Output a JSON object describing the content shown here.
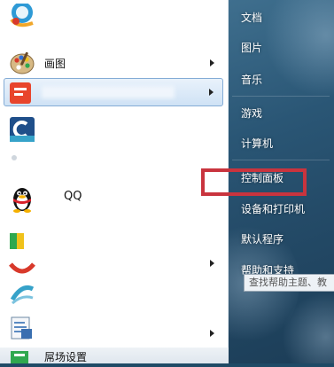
{
  "left_menu": {
    "items": [
      {
        "id": "top-app",
        "label": "",
        "icon": "browser-icon",
        "has_arrow": false
      },
      {
        "id": "paint",
        "label": "画图",
        "icon": "paint-palette-icon",
        "has_arrow": true
      },
      {
        "id": "pinned-app",
        "label": "",
        "icon": "app-icon",
        "has_arrow": true
      },
      {
        "id": "app-c",
        "label": "",
        "icon": "c-app-icon",
        "has_arrow": false
      },
      {
        "id": "qq",
        "label": "QQ",
        "icon": "qq-penguin-icon",
        "has_arrow": false
      },
      {
        "id": "green-app",
        "label": "",
        "icon": "green-app-icon",
        "has_arrow": false
      },
      {
        "id": "red-app",
        "label": "",
        "icon": "red-app-icon",
        "has_arrow": true
      },
      {
        "id": "teal-app",
        "label": "",
        "icon": "teal-app-icon",
        "has_arrow": false
      },
      {
        "id": "doc-app",
        "label": "",
        "icon": "document-app-icon",
        "has_arrow": true
      },
      {
        "id": "settings-partial",
        "label": "屌场设置",
        "icon": "settings-app-icon",
        "has_arrow": false
      }
    ]
  },
  "right_menu": {
    "items": [
      {
        "id": "documents",
        "label": "文档"
      },
      {
        "id": "pictures",
        "label": "图片"
      },
      {
        "id": "music",
        "label": "音乐"
      },
      {
        "id": "games",
        "label": "游戏"
      },
      {
        "id": "computer",
        "label": "计算机"
      },
      {
        "id": "control-panel",
        "label": "控制面板"
      },
      {
        "id": "devices-printers",
        "label": "设备和打印机"
      },
      {
        "id": "default-programs",
        "label": "默认程序"
      },
      {
        "id": "help-support",
        "label": "帮助和支持"
      }
    ]
  },
  "tooltip": {
    "text": "查找帮助主题、教"
  },
  "colors": {
    "highlight_box": "#c9343e",
    "right_panel": "#2a5675",
    "selected_item": "#cfe2f5"
  }
}
